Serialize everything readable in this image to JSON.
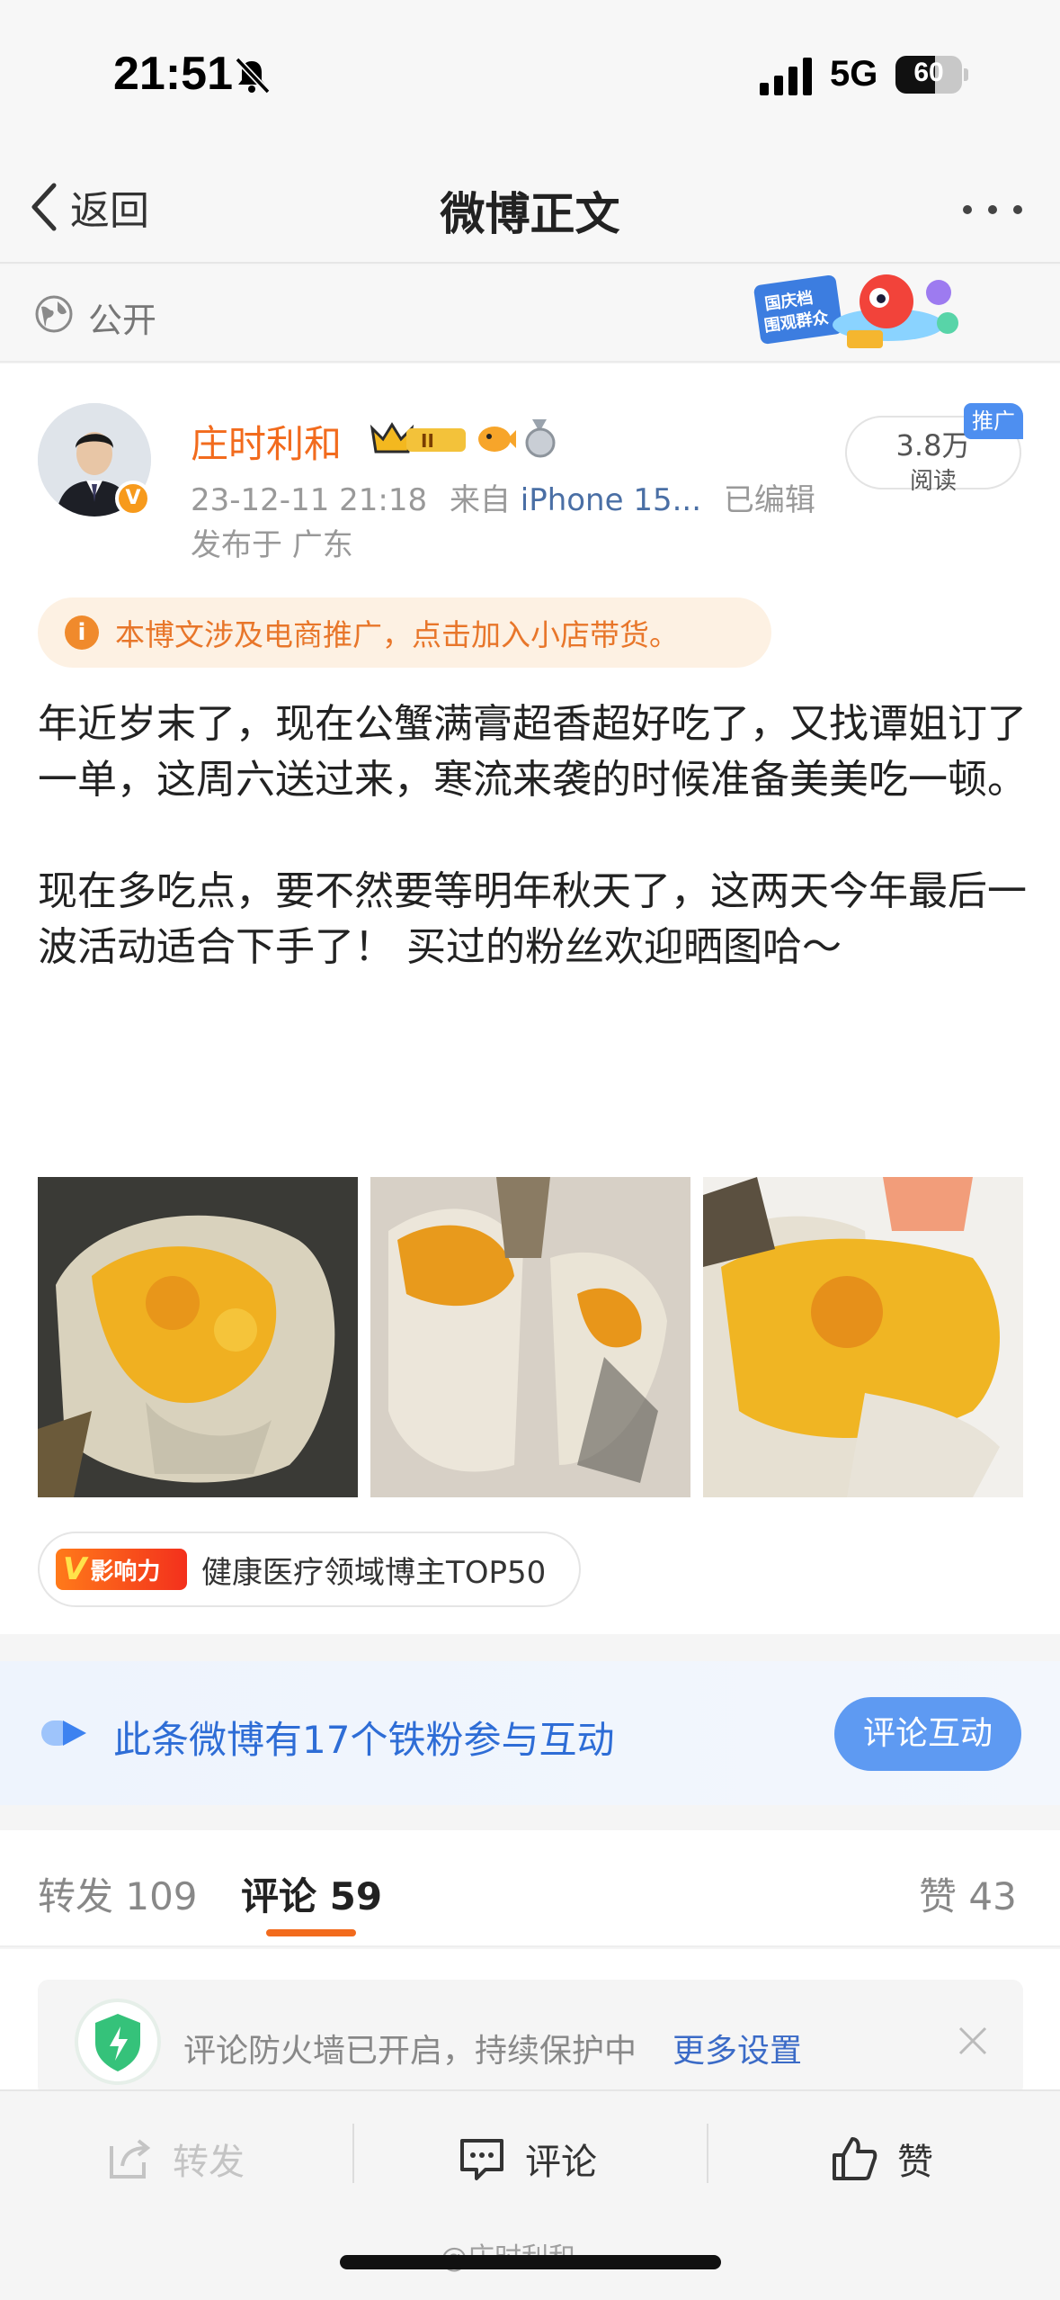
{
  "status_bar": {
    "time": "21:51",
    "network": "5G",
    "battery": "60",
    "battery_level": 0.6
  },
  "nav": {
    "back_label": "返回",
    "title": "微博正文"
  },
  "visibility": {
    "label": "公开",
    "banner_text": [
      "国庆档",
      "围观群众"
    ]
  },
  "post": {
    "author": "庄时利和",
    "timestamp": "23-12-11 21:18",
    "source_prefix": "来自",
    "device": "iPhone 15...",
    "edited": "已编辑",
    "location": "发布于 广东",
    "reads_count": "3.8万",
    "reads_label": "阅读",
    "promo_badge": "推广",
    "ecommerce_tip": "本博文涉及电商推广，点击加入小店带货。",
    "paragraphs": [
      "年近岁末了，现在公蟹满膏超香超好吃了，又找谭姐订了一单，这周六送过来，寒流来袭的时候准备美美吃一顿。",
      "现在多吃点，要不然要等明年秋天了，这两天今年最后一波活动适合下手了！ 买过的粉丝欢迎晒图哈～"
    ],
    "influence_badge": "影响力",
    "influence_text": "健康医疗领域博主TOP50"
  },
  "fans": {
    "text": "此条微博有17个铁粉参与互动",
    "button": "评论互动"
  },
  "tabs": {
    "repost": "转发 109",
    "comments": "评论 59",
    "likes": "赞 43"
  },
  "firewall": {
    "text": "评论防火墙已开启，持续保护中",
    "link": "更多设置"
  },
  "actions": {
    "repost": "转发",
    "comment": "评论",
    "like": "赞"
  },
  "watermark": "@庄时利和",
  "colors": {
    "accent": "#f26b1d",
    "link": "#4a6fa5",
    "blue_button": "#5e9af2"
  }
}
